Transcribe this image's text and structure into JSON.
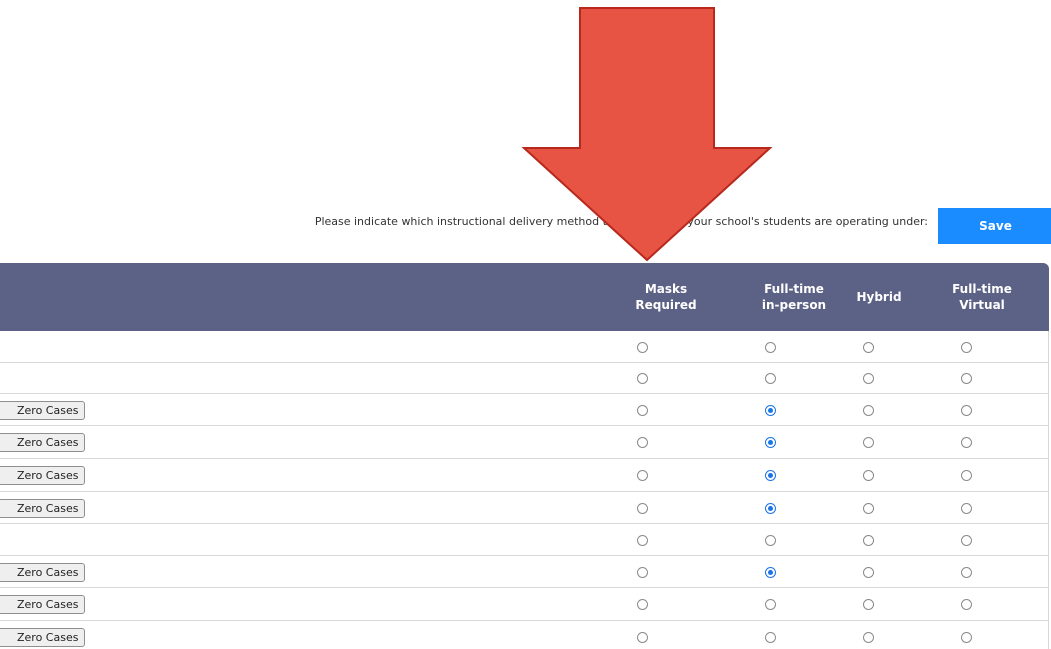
{
  "instruction": "Please indicate which instructional delivery method the majority of your school's students are operating under:",
  "save_label": "Save",
  "columns": [
    {
      "line1": "Masks",
      "line2": "Required"
    },
    {
      "line1": "Full-time",
      "line2": "in-person"
    },
    {
      "line1": "Hybrid",
      "line2": ""
    },
    {
      "line1": "Full-time",
      "line2": "Virtual"
    }
  ],
  "zero_cases_label": "Zero Cases",
  "rows": [
    {
      "zero_cases_button": false,
      "masks_required": false,
      "delivery": "none"
    },
    {
      "zero_cases_button": false,
      "masks_required": false,
      "delivery": "none"
    },
    {
      "zero_cases_button": true,
      "masks_required": false,
      "delivery": "full-time-in-person"
    },
    {
      "zero_cases_button": true,
      "masks_required": false,
      "delivery": "full-time-in-person"
    },
    {
      "zero_cases_button": true,
      "masks_required": false,
      "delivery": "full-time-in-person"
    },
    {
      "zero_cases_button": true,
      "masks_required": false,
      "delivery": "full-time-in-person"
    },
    {
      "zero_cases_button": false,
      "masks_required": false,
      "delivery": "none"
    },
    {
      "zero_cases_button": true,
      "masks_required": false,
      "delivery": "full-time-in-person"
    },
    {
      "zero_cases_button": true,
      "masks_required": false,
      "delivery": "none"
    },
    {
      "zero_cases_button": true,
      "masks_required": false,
      "delivery": "none"
    }
  ],
  "colors": {
    "header_bg": "#5c6186",
    "save_bg": "#1a8cff",
    "radio_checked": "#1a73e8",
    "arrow_fill": "#e85444",
    "arrow_stroke": "#b8281c"
  },
  "annotation": {
    "icon": "down-arrow-icon"
  }
}
